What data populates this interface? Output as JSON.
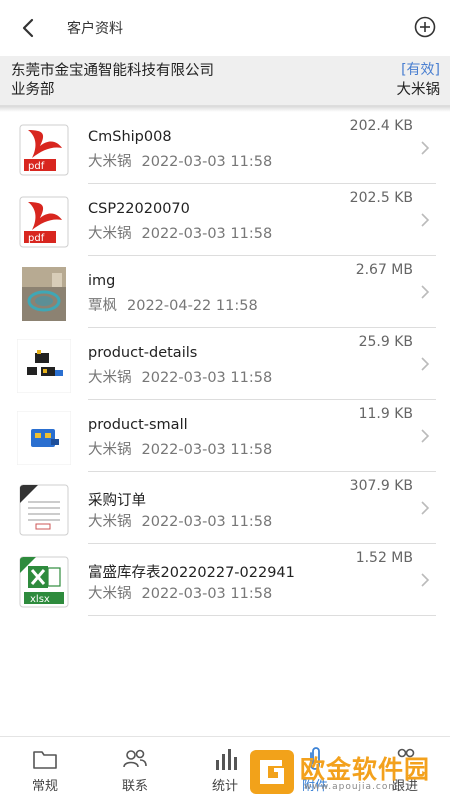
{
  "header": {
    "title": "客户资料"
  },
  "customer": {
    "company": "东莞市金宝通智能科技有限公司",
    "status": "[有效]",
    "department": "业务部",
    "owner": "大米锅"
  },
  "files": [
    {
      "name": "CmShip008",
      "user": "大米锅",
      "date": "2022-03-03 11:58",
      "size": "202.4 KB",
      "icon": "pdf-icon"
    },
    {
      "name": "CSP22020070",
      "user": "大米锅",
      "date": "2022-03-03 11:58",
      "size": "202.5 KB",
      "icon": "pdf-icon"
    },
    {
      "name": "img",
      "user": "覃枫",
      "date": "2022-04-22 11:58",
      "size": "2.67 MB",
      "icon": "photo-thumbnail"
    },
    {
      "name": "product-details",
      "user": "大米锅",
      "date": "2022-03-03 11:58",
      "size": "25.9 KB",
      "icon": "product-thumbnail"
    },
    {
      "name": "product-small",
      "user": "大米锅",
      "date": "2022-03-03 11:58",
      "size": "11.9 KB",
      "icon": "product-thumbnail"
    },
    {
      "name": "采购订单",
      "user": "大米锅",
      "date": "2022-03-03 11:58",
      "size": "307.9 KB",
      "icon": "document-icon"
    },
    {
      "name": "富盛库存表20220227-022941",
      "user": "大米锅",
      "date": "2022-03-03 11:58",
      "size": "1.52 MB",
      "icon": "xlsx-icon"
    }
  ],
  "nav": [
    {
      "label": "常规",
      "icon": "folder-icon"
    },
    {
      "label": "联系",
      "icon": "contacts-icon"
    },
    {
      "label": "统计",
      "icon": "bar-chart-icon"
    },
    {
      "label": "附件",
      "icon": "paperclip-icon",
      "active": true
    },
    {
      "label": "跟进",
      "icon": "follow-up-icon"
    }
  ],
  "watermark": {
    "text": "欧金软件园",
    "sub": "www.apoujia.com"
  },
  "colors": {
    "accent": "#3b82d6",
    "status": "#4a7fd0",
    "watermark": "#f3a11d"
  }
}
